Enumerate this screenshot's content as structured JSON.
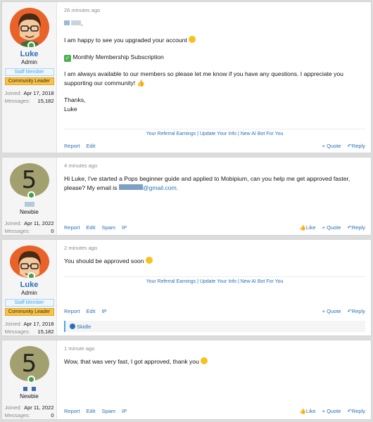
{
  "posts": [
    {
      "time": "26 minutes ago",
      "user": {
        "name": "Luke",
        "title": "Admin",
        "banners": [
          "Staff Member",
          "Community Leader"
        ],
        "joined_label": "Joined:",
        "joined": "Apr 17, 2018",
        "messages_label": "Messages:",
        "messages": "15,182"
      },
      "lines": [
        "I am happy to see you upgraded your account",
        "Monthly Membership Subscription",
        "I am always available to our members so please let me know if you have any questions. I appreciate you supporting our community!",
        "Thanks,",
        "Luke"
      ],
      "greeting_suffix": ",",
      "signature": "Your Referral Earnings | Update Your Info | New AI Bot For You",
      "actions_left": [
        "Report",
        "Edit"
      ],
      "actions_right": [
        "+ Quote",
        "Reply"
      ]
    },
    {
      "time": "4 minutes ago",
      "user": {
        "name": "",
        "title": "Newbie",
        "avatar_letter": "5",
        "joined_label": "Joined:",
        "joined": "Apr 11, 2022",
        "messages_label": "Messages:",
        "messages": "0"
      },
      "text_a": "Hi Luke, I've started a Pops beginner guide and applied to Mobipium, can you help me get approved faster, please? My email is",
      "email_tail": "@gmail.com.",
      "actions_left": [
        "Report",
        "Edit",
        "Spam",
        "IP"
      ],
      "actions_right": [
        "Like",
        "+ Quote",
        "Reply"
      ]
    },
    {
      "time": "2 minutes ago",
      "user": {
        "name": "Luke",
        "title": "Admin",
        "banners": [
          "Staff Member",
          "Community Leader"
        ],
        "joined_label": "Joined:",
        "joined": "Apr 17, 2018",
        "messages_label": "Messages:",
        "messages": "15,182"
      },
      "text": "You should be approved soon",
      "signature": "Your Referral Earnings | Update Your Info | New AI Bot For You",
      "actions_left": [
        "Report",
        "Edit",
        "IP"
      ],
      "actions_right": [
        "+ Quote",
        "Reply"
      ],
      "reaction": "Skidle"
    },
    {
      "time": "1 minute ago",
      "user": {
        "name": "",
        "title": "Newbie",
        "avatar_letter": "5",
        "joined_label": "Joined:",
        "joined": "Apr 11, 2022",
        "messages_label": "Messages:",
        "messages": "0"
      },
      "text": "Wow, that was very fast, I got approved, thank you",
      "actions_left": [
        "Report",
        "Edit",
        "Spam",
        "IP"
      ],
      "actions_right": [
        "Like",
        "+ Quote",
        "Reply"
      ]
    }
  ],
  "colors": {
    "accent": "#2b6fb6",
    "staff": "#47a7eb",
    "leader": "#f6c34c",
    "avatar_orange": "#e9622a",
    "avatar_olive": "#a3a070"
  }
}
